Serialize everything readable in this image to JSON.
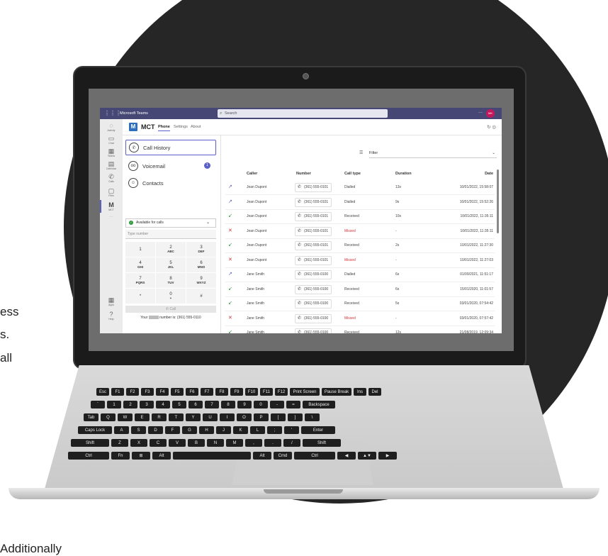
{
  "side_text": {
    "line1": "ess",
    "line2": "s.",
    "line3": "all",
    "line4": "Additionally"
  },
  "teams": {
    "app_name": "Microsoft Teams",
    "search_placeholder": "Search",
    "more": "···",
    "avatar_initials": "MK"
  },
  "rail": [
    {
      "label": "Activity",
      "icon": "bell-icon"
    },
    {
      "label": "Chat",
      "icon": "chat-icon"
    },
    {
      "label": "Teams",
      "icon": "teams-icon"
    },
    {
      "label": "Calendar",
      "icon": "calendar-icon"
    },
    {
      "label": "Calls",
      "icon": "phone-icon"
    },
    {
      "label": "Files",
      "icon": "file-icon"
    },
    {
      "label": "MCT",
      "icon": "mct-icon"
    },
    {
      "label": "···",
      "icon": "more-icon"
    },
    {
      "label": "Apps",
      "icon": "apps-icon"
    },
    {
      "label": "Help",
      "icon": "help-icon"
    }
  ],
  "app_header": {
    "logo_letter": "M",
    "name": "MCT",
    "tabs": [
      "Phone",
      "Settings",
      "About"
    ],
    "active_tab": "Phone"
  },
  "nav": [
    {
      "label": "Call History",
      "icon": "phone-icon",
      "selected": true
    },
    {
      "label": "Voicemail",
      "icon": "voicemail-icon",
      "badge": "1"
    },
    {
      "label": "Contacts",
      "icon": "contacts-icon"
    }
  ],
  "status": {
    "label": "Available for calls"
  },
  "dialer": {
    "placeholder": "Type number",
    "keys": [
      {
        "digit": "1",
        "letters": ""
      },
      {
        "digit": "2",
        "letters": "ABC"
      },
      {
        "digit": "3",
        "letters": "DEF"
      },
      {
        "digit": "4",
        "letters": "GHI"
      },
      {
        "digit": "5",
        "letters": "JKL"
      },
      {
        "digit": "6",
        "letters": "MNO"
      },
      {
        "digit": "7",
        "letters": "PQRS"
      },
      {
        "digit": "8",
        "letters": "TUV"
      },
      {
        "digit": "9",
        "letters": "WXYZ"
      },
      {
        "digit": "*",
        "letters": ""
      },
      {
        "digit": "0",
        "letters": "+"
      },
      {
        "digit": "#",
        "letters": ""
      }
    ],
    "call_label": "Call",
    "your_number_prefix": "Your",
    "your_number_suffix": "number is: (361) 555-0110"
  },
  "filter": {
    "label": "Filter"
  },
  "table": {
    "headers": [
      "Caller",
      "Number",
      "Call type",
      "Duration",
      "Date"
    ],
    "rows": [
      {
        "caller": "Jean Dupont",
        "number": "(361) 555-0101",
        "type": "Dialled",
        "duration": "13s",
        "date": "10/01/2022, 15:58:07"
      },
      {
        "caller": "Jean Dupont",
        "number": "(361) 555-0101",
        "type": "Dialled",
        "duration": "9s",
        "date": "10/01/2022, 15:52:26"
      },
      {
        "caller": "Jean Dupont",
        "number": "(361) 555-0101",
        "type": "Received",
        "duration": "10s",
        "date": "10/01/2022, 11:35:11"
      },
      {
        "caller": "Jean Dupont",
        "number": "(361) 555-0101",
        "type": "Missed",
        "duration": "-",
        "date": "10/01/2022, 11:35:11"
      },
      {
        "caller": "Jean Dupont",
        "number": "(361) 555-0101",
        "type": "Received",
        "duration": "2s",
        "date": "10/01/2022, 11:27:30"
      },
      {
        "caller": "Jean Dupont",
        "number": "(361) 555-0101",
        "type": "Missed",
        "duration": "-",
        "date": "10/01/2022, 11:27:03"
      },
      {
        "caller": "Jane Smith",
        "number": "(361) 555-0100",
        "type": "Dialled",
        "duration": "6s",
        "date": "01/09/2021, 11:51:17"
      },
      {
        "caller": "Jane Smith",
        "number": "(361) 555-0100",
        "type": "Received",
        "duration": "6s",
        "date": "15/01/2020, 11:01:57"
      },
      {
        "caller": "Jane Smith",
        "number": "(361) 555-0100",
        "type": "Received",
        "duration": "5s",
        "date": "03/01/2020, 07:54:42"
      },
      {
        "caller": "Jane Smith",
        "number": "(361) 555-0100",
        "type": "Missed",
        "duration": "-",
        "date": "03/01/2020, 07:57:42"
      },
      {
        "caller": "Jane Smith",
        "number": "(361) 555-0100",
        "type": "Received",
        "duration": "12s",
        "date": "21/08/2019, 12:09:34"
      }
    ]
  },
  "keyboard": {
    "row1": [
      "Esc",
      "F1",
      "F2",
      "F3",
      "F4",
      "F5",
      "F6",
      "F7",
      "F8",
      "F9",
      "F10",
      "F11",
      "F12",
      "Print Screen",
      "Pause Break",
      "Ins",
      "Del"
    ],
    "row2": [
      "`",
      "1",
      "2",
      "3",
      "4",
      "5",
      "6",
      "7",
      "8",
      "9",
      "0",
      "-",
      "=",
      "Backspace"
    ],
    "row3": [
      "Tab",
      "Q",
      "W",
      "E",
      "R",
      "T",
      "Y",
      "U",
      "I",
      "O",
      "P",
      "[",
      "]",
      "\\"
    ],
    "row4": [
      "Caps Lock",
      "A",
      "S",
      "D",
      "F",
      "G",
      "H",
      "J",
      "K",
      "L",
      ";",
      "'",
      "Enter"
    ],
    "row5": [
      "Shift",
      "Z",
      "X",
      "C",
      "V",
      "B",
      "N",
      "M",
      ",",
      ".",
      "/",
      "Shift"
    ],
    "row6": [
      "Ctrl",
      "Fn",
      "⊞",
      "Alt",
      "",
      "Alt",
      "Cmd",
      "Ctrl",
      "◀",
      "▲▼",
      "▶"
    ]
  },
  "colors": {
    "teams_bar": "#464775",
    "accent": "#5b5fc7",
    "missed": "#d13438",
    "received": "#2e9a3a",
    "dialled": "#5b5fc7"
  }
}
